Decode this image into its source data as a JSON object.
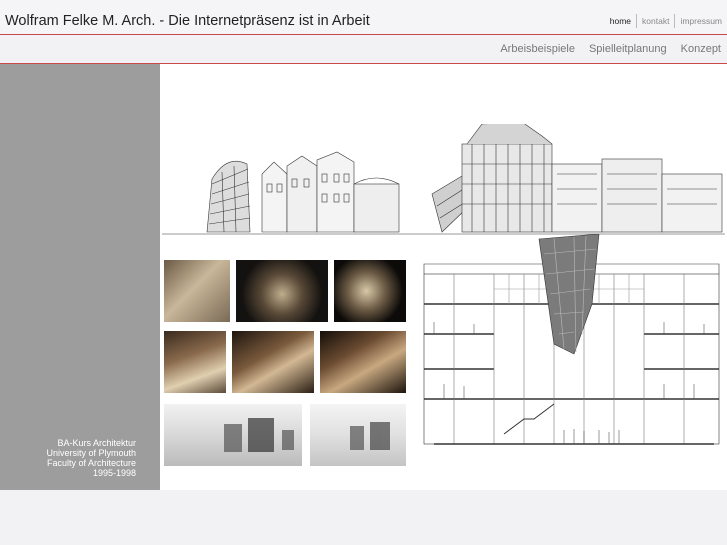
{
  "header": {
    "title": "Wolfram Felke M. Arch. - Die Internetpräsenz ist in Arbeit",
    "links": [
      "home",
      "kontakt",
      "impressum"
    ]
  },
  "menu": {
    "items": [
      "Arbeisbeispiele",
      "Spielleitplanung",
      "Konzept"
    ]
  },
  "sidebar": {
    "caption_lines": [
      "BA-Kurs Architektur",
      "University of Plymouth",
      "Faculty of Architecture",
      "1995-1998"
    ]
  },
  "colors": {
    "accent_line": "#c94a4a",
    "sidebar": "#9d9d9d",
    "page_bg": "#f2f2f4"
  }
}
